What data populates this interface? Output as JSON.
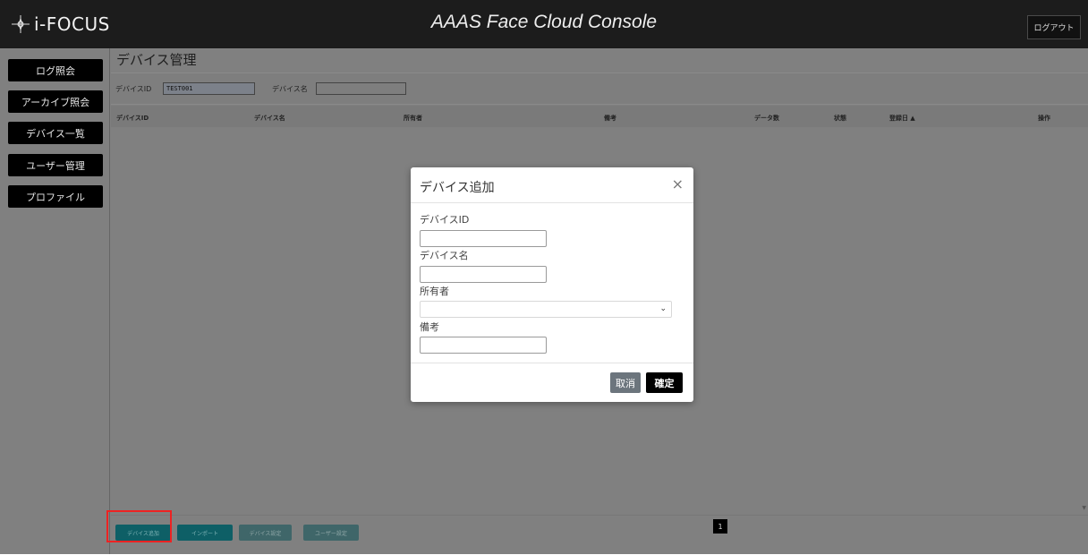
{
  "header": {
    "logo_text": "i-FOCUS",
    "app_title": "AAAS Face Cloud Console",
    "logout_label": "ログアウト"
  },
  "sidebar": {
    "items": [
      {
        "label": "ログ照会"
      },
      {
        "label": "アーカイブ照会"
      },
      {
        "label": "デバイス一覧"
      },
      {
        "label": "ユーザー管理"
      },
      {
        "label": "プロファイル"
      }
    ]
  },
  "main": {
    "page_title": "デバイス管理",
    "filter": {
      "device_id_label": "デバイスID",
      "device_id_value": "TEST001",
      "device_name_label": "デバイス名",
      "device_name_value": ""
    },
    "table_columns": [
      "デバイスID",
      "デバイス名",
      "所有者",
      "備考",
      "データ数",
      "状態",
      "登録日 ▲",
      "操作"
    ],
    "actions": [
      "デバイス追加",
      "インポート",
      "デバイス設定",
      "ユーザー設定"
    ],
    "pagination": {
      "current_page": "1"
    }
  },
  "modal": {
    "title": "デバイス追加",
    "close_glyph": "×",
    "fields": [
      {
        "label": "デバイスID",
        "value": ""
      },
      {
        "label": "デバイス名",
        "value": ""
      },
      {
        "label": "所有者",
        "value": ""
      },
      {
        "label": "備考",
        "value": ""
      }
    ],
    "cancel_label": "取消",
    "confirm_label": "確定"
  },
  "colors": {
    "header_bg": "#1c1c1c",
    "backdrop": "#808080",
    "action_teal": "#0e5f66",
    "highlight": "#ee2222"
  }
}
